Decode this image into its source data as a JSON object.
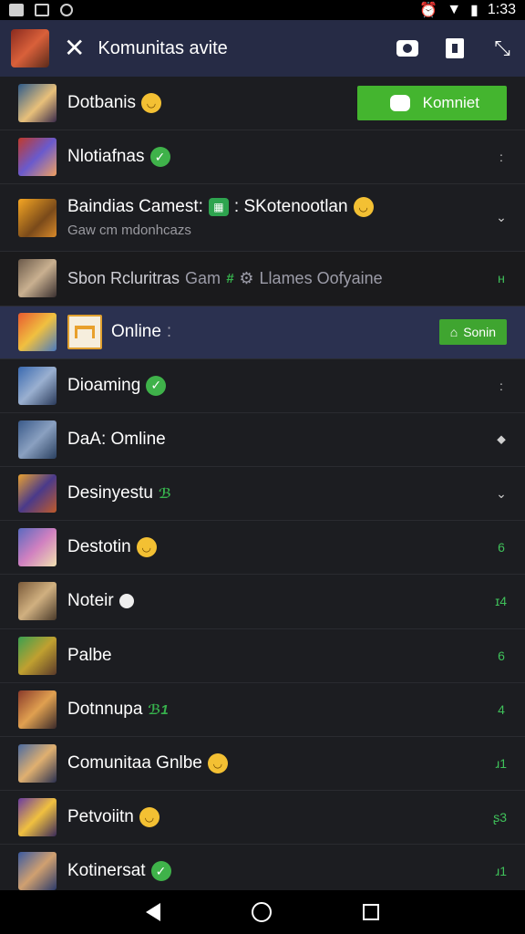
{
  "status_bar": {
    "time": "1:33"
  },
  "header": {
    "title": "Komunitas avite"
  },
  "join_button_label": "Komniet",
  "online_button_label": "Sonin",
  "rows": [
    {
      "name": "Dotbanis",
      "right": ""
    },
    {
      "name": "Nlotiafnas",
      "right": ":"
    },
    {
      "name": "Baindias Camest:",
      "name2": ": SKotenootlan",
      "sub": "Gaw cm mdonhcazs",
      "right": "⌄"
    },
    {
      "name": "Sbon Rcluritras",
      "name2": "Gam",
      "name3": "Llames Oofyaine",
      "right": "ʜ"
    },
    {
      "name": "Online",
      "suffix": ":"
    },
    {
      "name": "Dioaming",
      "right": ":"
    },
    {
      "name": "DaA: Omline",
      "right": "⬥"
    },
    {
      "name": "Desinyestu",
      "tag": "ℬ",
      "right": "⌄"
    },
    {
      "name": "Destotin",
      "right": "6"
    },
    {
      "name": "Noteir",
      "right": "ɪ4"
    },
    {
      "name": "Palbe",
      "right": "6"
    },
    {
      "name": "Dotnnupa",
      "tag": "ℬ1",
      "right": "4"
    },
    {
      "name": "Comunitaa Gnlbe",
      "right": "ɹ1"
    },
    {
      "name": "Petvoiitn",
      "right": "ʂ3"
    },
    {
      "name": "Kotinersat",
      "right": "ɹ1"
    }
  ],
  "colors": {
    "header_bg": "#262b45",
    "list_bg": "#1c1d21",
    "highlight_bg": "#2b3150",
    "accent_green": "#44b52f"
  },
  "icons": [
    "gmail-icon",
    "image-icon",
    "alarm-icon",
    "wifi-icon",
    "battery-icon",
    "close-icon",
    "camera-icon",
    "share-icon",
    "collapse-icon",
    "chat-icon",
    "emoji-icon",
    "check-icon",
    "back-icon",
    "home-icon",
    "recents-icon"
  ]
}
